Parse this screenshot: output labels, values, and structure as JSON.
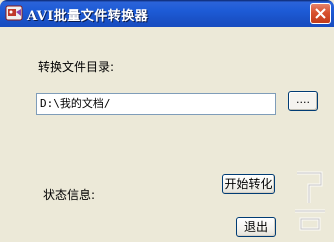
{
  "window": {
    "title": "AVI批量文件转换器",
    "app_icon": "video-camera-icon",
    "close_icon": "close-icon"
  },
  "form": {
    "dir_label": "转换文件目录:",
    "dir_value": "D:\\我的文档/",
    "browse_label": "....",
    "status_label": "状态信息:"
  },
  "buttons": {
    "start_label": "开始转化",
    "exit_label": "退出"
  },
  "colors": {
    "titlebar": "#1d5bd6",
    "close_button": "#d8512f",
    "window_bg": "#ece9d8"
  }
}
